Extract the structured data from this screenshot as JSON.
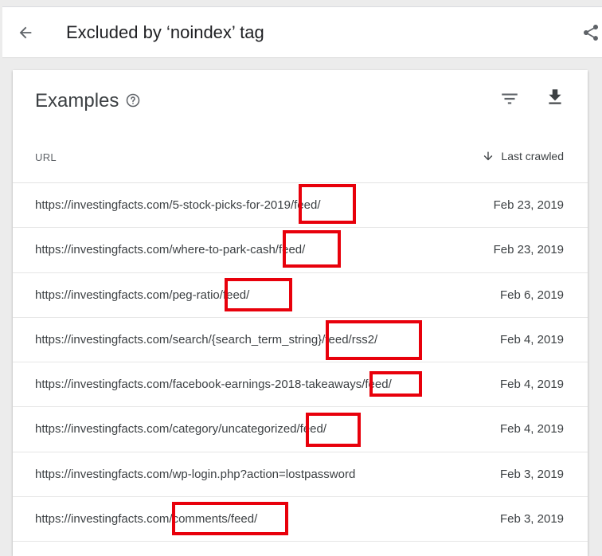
{
  "header": {
    "title": "Excluded by ‘noindex’ tag",
    "back_icon": "arrow-back-icon",
    "share_icon": "share-icon"
  },
  "card": {
    "title": "Examples",
    "help_icon": "help-circle-icon",
    "filter_icon": "filter-list-icon",
    "download_icon": "download-icon"
  },
  "table": {
    "columns": [
      "URL",
      "Last crawled"
    ],
    "sort_icon": "arrow-down-icon",
    "rows": [
      {
        "url": "https://investingfacts.com/5-stock-picks-for-2019/feed/",
        "date": "Feb 23, 2019"
      },
      {
        "url": "https://investingfacts.com/where-to-park-cash/feed/",
        "date": "Feb 23, 2019"
      },
      {
        "url": "https://investingfacts.com/peg-ratio/feed/",
        "date": "Feb 6, 2019"
      },
      {
        "url": "https://investingfacts.com/search/{search_term_string}/feed/rss2/",
        "date": "Feb 4, 2019"
      },
      {
        "url": "https://investingfacts.com/facebook-earnings-2018-takeaways/feed/",
        "date": "Feb 4, 2019"
      },
      {
        "url": "https://investingfacts.com/category/uncategorized/feed/",
        "date": "Feb 4, 2019"
      },
      {
        "url": "https://investingfacts.com/wp-login.php?action=lostpassword",
        "date": "Feb 3, 2019"
      },
      {
        "url": "https://investingfacts.com/comments/feed/",
        "date": "Feb 3, 2019"
      }
    ]
  },
  "colors": {
    "highlight": "#e8000b",
    "text": "#3c4043",
    "muted": "#5f6368"
  }
}
